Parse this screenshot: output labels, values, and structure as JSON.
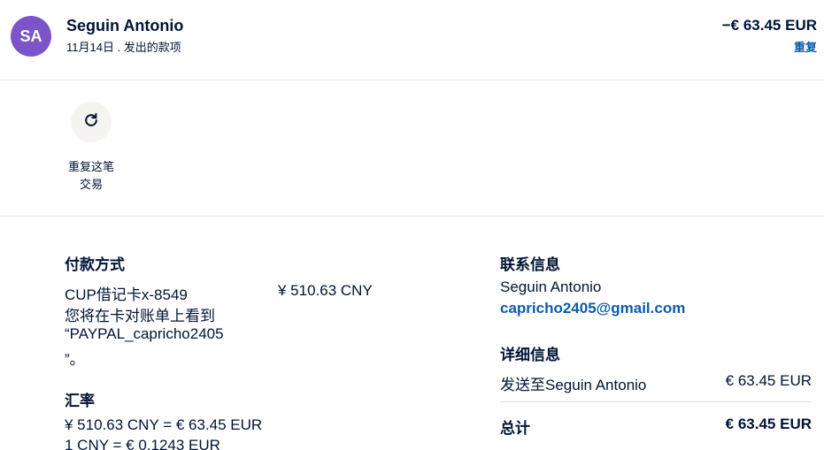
{
  "header": {
    "avatar_initials": "SA",
    "name": "Seguin Antonio",
    "subtitle": "11月14日 . 发出的款项",
    "amount": "−€ 63.45 EUR",
    "repeat_link": "重复"
  },
  "actions": {
    "repeat_line1": "重复这笔",
    "repeat_line2": "交易",
    "repeat_icon": "refresh-icon"
  },
  "payment": {
    "title": "付款方式",
    "card": "CUP借记卡x-8549",
    "amount_cny": "¥ 510.63 CNY",
    "statement_line1": "您将在卡对账单上看到",
    "statement_line2": "“PAYPAL_capricho2405",
    "statement_line3": "”。"
  },
  "exchange": {
    "title": "汇率",
    "line1": "¥ 510.63 CNY = € 63.45 EUR",
    "line2": "1 CNY = € 0.1243 EUR"
  },
  "contact": {
    "title": "联系信息",
    "name": "Seguin Antonio",
    "email": "capricho2405@gmail.com"
  },
  "details": {
    "title": "详细信息",
    "sent_to": "发送至Seguin Antonio",
    "sent_amount": "€ 63.45 EUR",
    "total_label": "总计",
    "total_amount": "€ 63.45 EUR"
  },
  "colors": {
    "avatar": "#7b54c9",
    "link": "#0a5cae",
    "text": "#001435"
  }
}
